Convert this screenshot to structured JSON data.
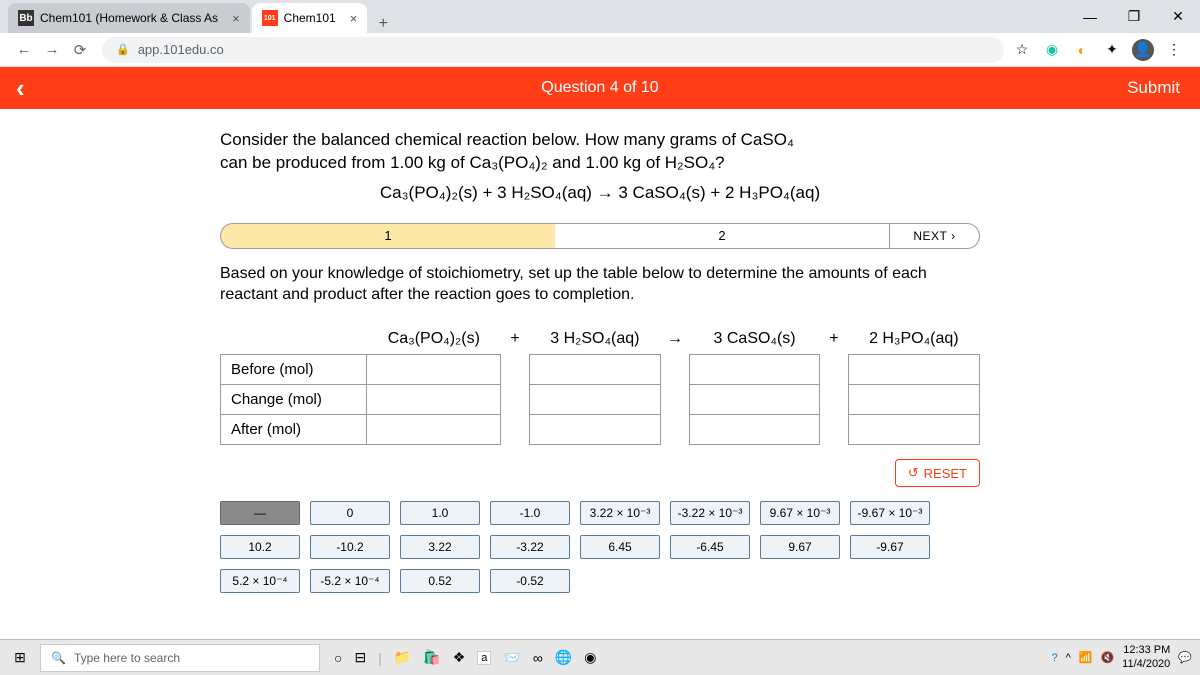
{
  "browser": {
    "tabs": [
      {
        "icon": "Bb",
        "title": "Chem101 (Homework & Class As"
      },
      {
        "icon": "101",
        "title": "Chem101"
      }
    ],
    "url": "app.101edu.co"
  },
  "header": {
    "question_counter": "Question 4 of 10",
    "submit": "Submit"
  },
  "question": {
    "line1": "Consider the balanced chemical reaction below. How many grams of CaSO₄",
    "line2": "can be produced from 1.00 kg of Ca₃(PO₄)₂ and 1.00 kg of H₂SO₄?",
    "equation": "Ca₃(PO₄)₂(s) + 3 H₂SO₄(aq) → 3 CaSO₄(s) + 2 H₃PO₄(aq)"
  },
  "steps": {
    "one": "1",
    "two": "2",
    "next": "NEXT",
    "text": "Based on your knowledge of stoichiometry, set up the table below to determine the amounts of each reactant and product after the reaction goes to completion."
  },
  "table": {
    "cols": [
      "Ca₃(PO₄)₂(s)",
      "3 H₂SO₄(aq)",
      "3 CaSO₄(s)",
      "2 H₃PO₄(aq)"
    ],
    "plus": "+",
    "arrow": "→",
    "rows": [
      "Before (mol)",
      "Change (mol)",
      "After (mol)"
    ]
  },
  "reset": "RESET",
  "tiles": [
    "—",
    "0",
    "1.0",
    "-1.0",
    "3.22 × 10⁻³",
    "-3.22 × 10⁻³",
    "9.67 × 10⁻³",
    "-9.67 × 10⁻³",
    "10.2",
    "-10.2",
    "3.22",
    "-3.22",
    "6.45",
    "-6.45",
    "9.67",
    "-9.67",
    "5.2 × 10⁻⁴",
    "-5.2 × 10⁻⁴",
    "0.52",
    "-0.52"
  ],
  "taskbar": {
    "search_placeholder": "Type here to search",
    "time": "12:33 PM",
    "date": "11/4/2020"
  }
}
